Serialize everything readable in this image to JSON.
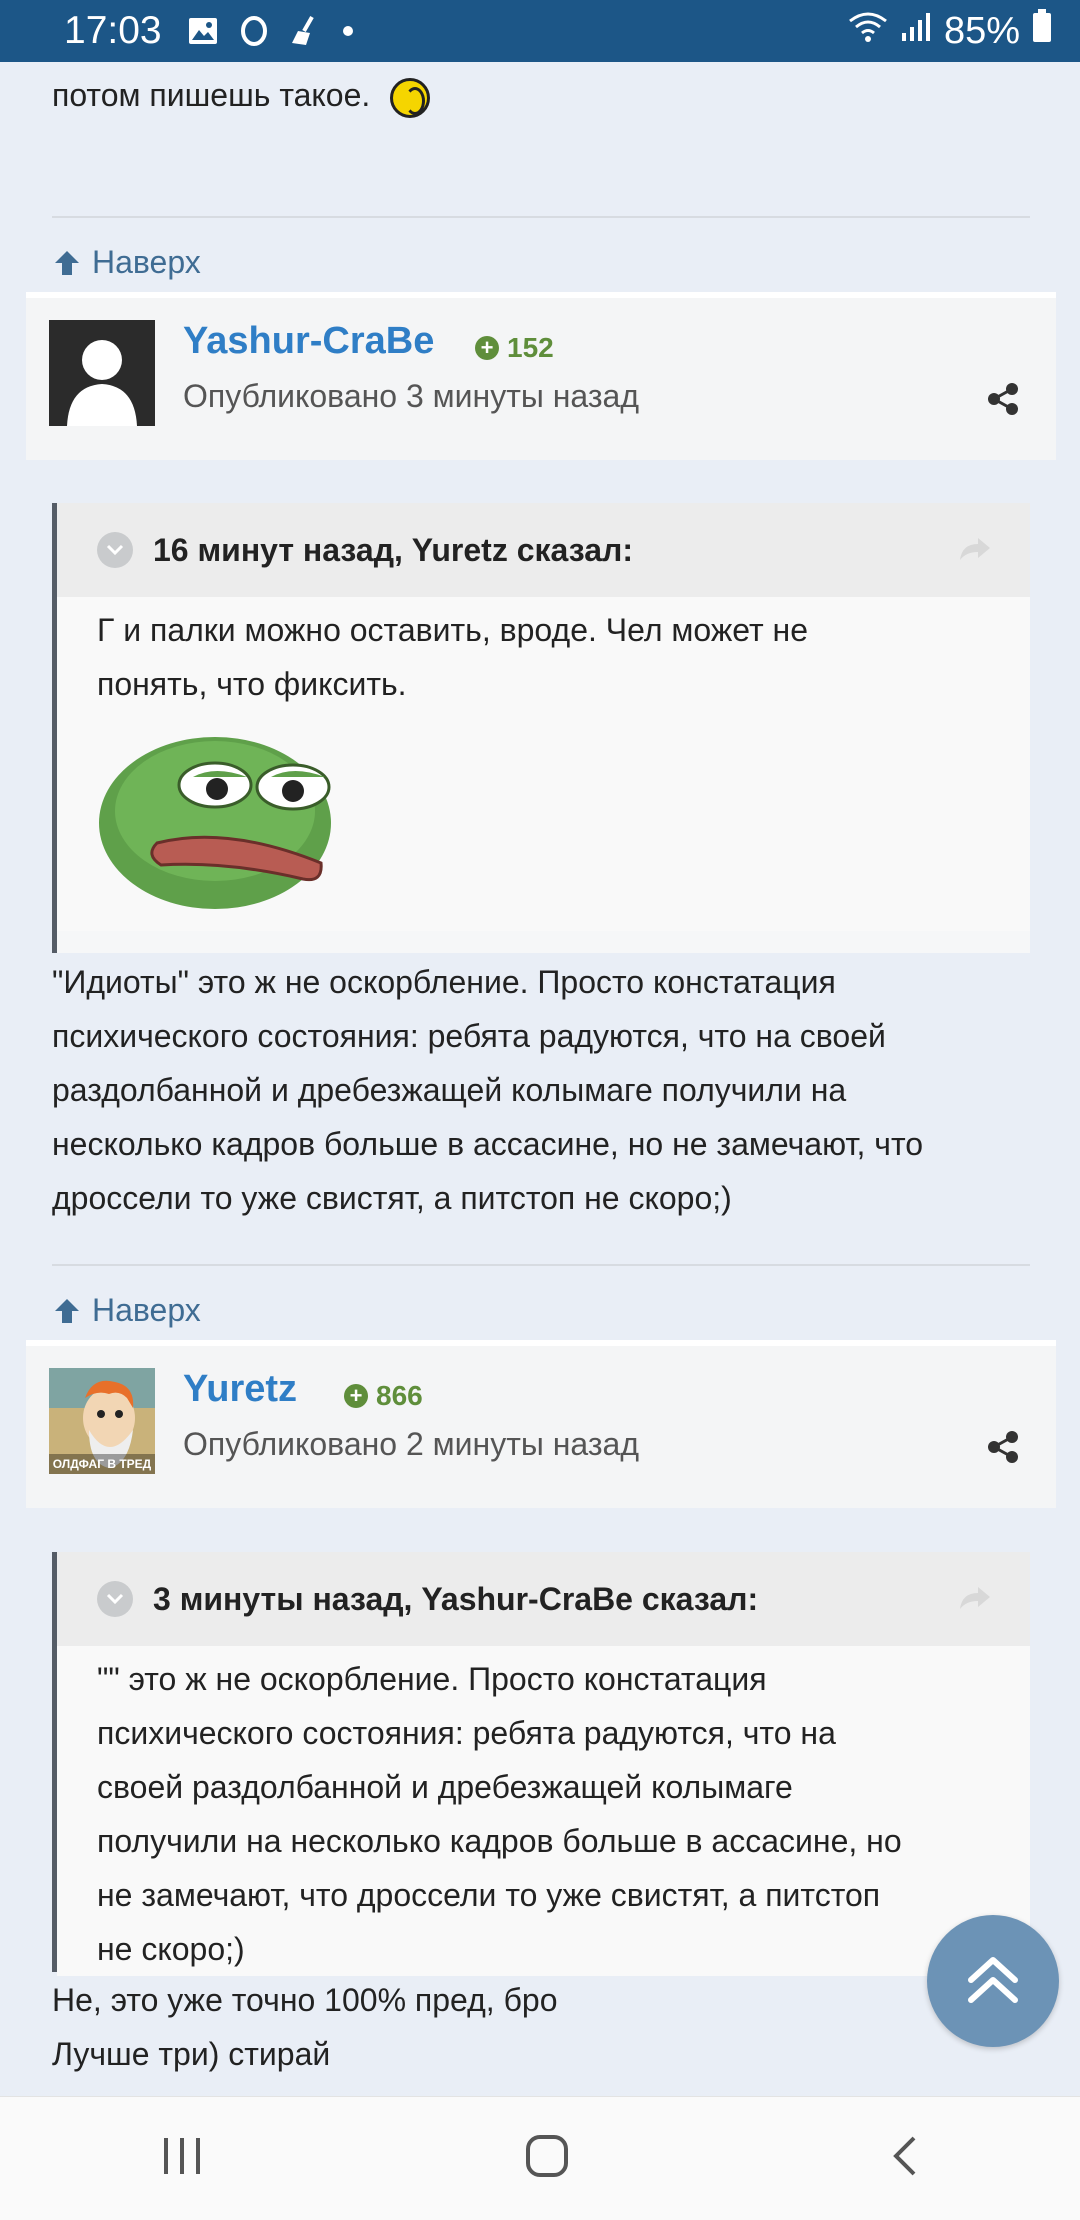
{
  "status_bar": {
    "time": "17:03",
    "battery": "85%",
    "icons": [
      "image-icon",
      "circle-icon",
      "broom-icon",
      "dot-icon",
      "wifi-icon",
      "signal-icon",
      "battery-icon"
    ]
  },
  "prev_post": {
    "last_line": "потом пишешь такое."
  },
  "back_to_top_label": "Наверх",
  "posts": [
    {
      "author": "Yashur-CraBe",
      "reputation": "152",
      "posted": "Опубликовано 3 минуты назад",
      "quote": {
        "header": "16 минут назад, Yuretz сказал:",
        "lines": [
          "Г и палки можно оставить, вроде. Чел может не",
          "понять, что фиксить."
        ]
      },
      "body_lines": [
        "\"Идиоты\" это ж не оскорбление. Просто констатация",
        "психического состояния: ребята радуются, что на своей",
        "раздолбанной и дребезжащей колымаге получили на",
        "несколько кадров больше в ассасине, но не замечают, что",
        "дроссели то уже свистят, а питстоп не скоро;)"
      ]
    },
    {
      "author": "Yuretz",
      "reputation": "866",
      "avatar_caption": "ОЛДФАГ В ТРЕД",
      "posted": "Опубликовано 2 минуты назад",
      "quote": {
        "header": "3 минуты назад, Yashur-CraBe сказал:",
        "lines": [
          "\"\" это ж не оскорбление. Просто констатация",
          "психического состояния: ребята радуются, что на",
          "своей раздолбанной и дребезжащей колымаге",
          "получили на несколько кадров больше в ассасине, но",
          "не замечают, что дроссели то уже свистят, а питстоп",
          "не скоро;)"
        ]
      },
      "body_lines": [
        "Не, это уже точно 100% пред, бро",
        "Лучше три) стирай"
      ]
    }
  ],
  "colors": {
    "status_bar": "#1c5687",
    "author_link": "#2f7ec6",
    "reputation": "#5f8e3b",
    "back_link": "#3f6c93",
    "scroll_button": "#6c93b6"
  }
}
